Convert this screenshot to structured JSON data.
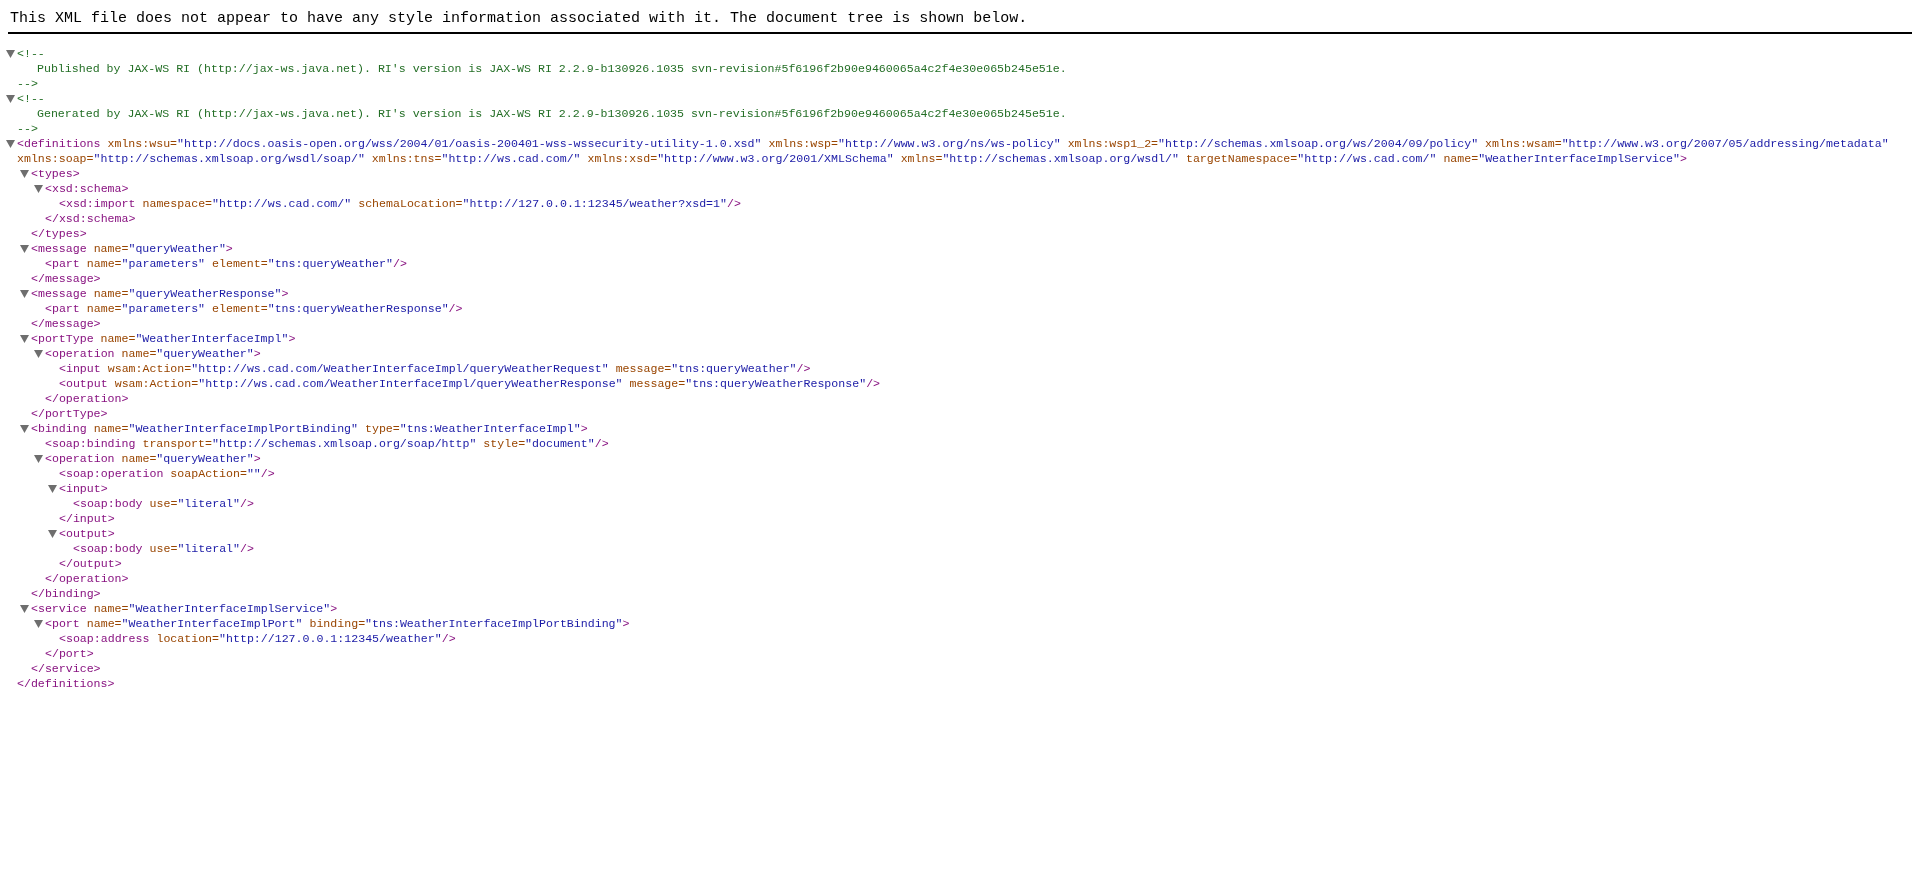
{
  "notice": "This XML file does not appear to have any style information associated with it. The document tree is shown below.",
  "tree": [
    {
      "kind": "comment",
      "expanded": true,
      "open": "<!--",
      "text": "Published by JAX-WS RI (http://jax-ws.java.net). RI's version is JAX-WS RI 2.2.9-b130926.1035 svn-revision#5f6196f2b90e9460065a4c2f4e30e065b245e51e.",
      "close": "-->"
    },
    {
      "kind": "comment",
      "expanded": true,
      "open": "<!--",
      "text": "Generated by JAX-WS RI (http://jax-ws.java.net). RI's version is JAX-WS RI 2.2.9-b130926.1035 svn-revision#5f6196f2b90e9460065a4c2f4e30e065b245e51e.",
      "close": "-->"
    },
    {
      "kind": "element",
      "expanded": true,
      "start": "<definitions",
      "attrs": [
        {
          "name": "xmlns:wsu=",
          "value": "\"http://docs.oasis-open.org/wss/2004/01/oasis-200401-wss-wssecurity-utility-1.0.xsd\""
        },
        {
          "name": "xmlns:wsp=",
          "value": "\"http://www.w3.org/ns/ws-policy\""
        },
        {
          "name": "xmlns:wsp1_2=",
          "value": "\"http://schemas.xmlsoap.org/ws/2004/09/policy\""
        },
        {
          "name": "xmlns:wsam=",
          "value": "\"http://www.w3.org/2007/05/addressing/metadata\""
        },
        {
          "name": "xmlns:soap=",
          "value": "\"http://schemas.xmlsoap.org/wsdl/soap/\""
        },
        {
          "name": "xmlns:tns=",
          "value": "\"http://ws.cad.com/\""
        },
        {
          "name": "xmlns:xsd=",
          "value": "\"http://www.w3.org/2001/XMLSchema\""
        },
        {
          "name": "xmlns=",
          "value": "\"http://schemas.xmlsoap.org/wsdl/\""
        },
        {
          "name": "targetNamespace=",
          "value": "\"http://ws.cad.com/\""
        },
        {
          "name": "name=",
          "value": "\"WeatherInterfaceImplService\""
        }
      ],
      "end": ">",
      "close": "</definitions>",
      "children": [
        {
          "kind": "element",
          "expanded": true,
          "start": "<types",
          "end": ">",
          "close": "</types>",
          "children": [
            {
              "kind": "element",
              "expanded": true,
              "start": "<xsd:schema",
              "end": ">",
              "close": "</xsd:schema>",
              "children": [
                {
                  "kind": "element",
                  "start": "<xsd:import",
                  "attrs": [
                    {
                      "name": "namespace=",
                      "value": "\"http://ws.cad.com/\""
                    },
                    {
                      "name": "schemaLocation=",
                      "value": "\"http://127.0.0.1:12345/weather?xsd=1\""
                    }
                  ],
                  "end": "/>"
                }
              ]
            }
          ]
        },
        {
          "kind": "element",
          "expanded": true,
          "start": "<message",
          "attrs": [
            {
              "name": "name=",
              "value": "\"queryWeather\""
            }
          ],
          "end": ">",
          "close": "</message>",
          "children": [
            {
              "kind": "element",
              "start": "<part",
              "attrs": [
                {
                  "name": "name=",
                  "value": "\"parameters\""
                },
                {
                  "name": "element=",
                  "value": "\"tns:queryWeather\""
                }
              ],
              "end": "/>"
            }
          ]
        },
        {
          "kind": "element",
          "expanded": true,
          "start": "<message",
          "attrs": [
            {
              "name": "name=",
              "value": "\"queryWeatherResponse\""
            }
          ],
          "end": ">",
          "close": "</message>",
          "children": [
            {
              "kind": "element",
              "start": "<part",
              "attrs": [
                {
                  "name": "name=",
                  "value": "\"parameters\""
                },
                {
                  "name": "element=",
                  "value": "\"tns:queryWeatherResponse\""
                }
              ],
              "end": "/>"
            }
          ]
        },
        {
          "kind": "element",
          "expanded": true,
          "start": "<portType",
          "attrs": [
            {
              "name": "name=",
              "value": "\"WeatherInterfaceImpl\""
            }
          ],
          "end": ">",
          "close": "</portType>",
          "children": [
            {
              "kind": "element",
              "expanded": true,
              "start": "<operation",
              "attrs": [
                {
                  "name": "name=",
                  "value": "\"queryWeather\""
                }
              ],
              "end": ">",
              "close": "</operation>",
              "children": [
                {
                  "kind": "element",
                  "start": "<input",
                  "attrs": [
                    {
                      "name": "wsam:Action=",
                      "value": "\"http://ws.cad.com/WeatherInterfaceImpl/queryWeatherRequest\""
                    },
                    {
                      "name": "message=",
                      "value": "\"tns:queryWeather\""
                    }
                  ],
                  "end": "/>"
                },
                {
                  "kind": "element",
                  "start": "<output",
                  "attrs": [
                    {
                      "name": "wsam:Action=",
                      "value": "\"http://ws.cad.com/WeatherInterfaceImpl/queryWeatherResponse\""
                    },
                    {
                      "name": "message=",
                      "value": "\"tns:queryWeatherResponse\""
                    }
                  ],
                  "end": "/>"
                }
              ]
            }
          ]
        },
        {
          "kind": "element",
          "expanded": true,
          "start": "<binding",
          "attrs": [
            {
              "name": "name=",
              "value": "\"WeatherInterfaceImplPortBinding\""
            },
            {
              "name": "type=",
              "value": "\"tns:WeatherInterfaceImpl\""
            }
          ],
          "end": ">",
          "close": "</binding>",
          "children": [
            {
              "kind": "element",
              "start": "<soap:binding",
              "attrs": [
                {
                  "name": "transport=",
                  "value": "\"http://schemas.xmlsoap.org/soap/http\""
                },
                {
                  "name": "style=",
                  "value": "\"document\""
                }
              ],
              "end": "/>"
            },
            {
              "kind": "element",
              "expanded": true,
              "start": "<operation",
              "attrs": [
                {
                  "name": "name=",
                  "value": "\"queryWeather\""
                }
              ],
              "end": ">",
              "close": "</operation>",
              "children": [
                {
                  "kind": "element",
                  "start": "<soap:operation",
                  "attrs": [
                    {
                      "name": "soapAction=",
                      "value": "\"\""
                    }
                  ],
                  "end": "/>"
                },
                {
                  "kind": "element",
                  "expanded": true,
                  "start": "<input",
                  "end": ">",
                  "close": "</input>",
                  "children": [
                    {
                      "kind": "element",
                      "start": "<soap:body",
                      "attrs": [
                        {
                          "name": "use=",
                          "value": "\"literal\""
                        }
                      ],
                      "end": "/>"
                    }
                  ]
                },
                {
                  "kind": "element",
                  "expanded": true,
                  "start": "<output",
                  "end": ">",
                  "close": "</output>",
                  "children": [
                    {
                      "kind": "element",
                      "start": "<soap:body",
                      "attrs": [
                        {
                          "name": "use=",
                          "value": "\"literal\""
                        }
                      ],
                      "end": "/>"
                    }
                  ]
                }
              ]
            }
          ]
        },
        {
          "kind": "element",
          "expanded": true,
          "start": "<service",
          "attrs": [
            {
              "name": "name=",
              "value": "\"WeatherInterfaceImplService\""
            }
          ],
          "end": ">",
          "close": "</service>",
          "children": [
            {
              "kind": "element",
              "expanded": true,
              "start": "<port",
              "attrs": [
                {
                  "name": "name=",
                  "value": "\"WeatherInterfaceImplPort\""
                },
                {
                  "name": "binding=",
                  "value": "\"tns:WeatherInterfaceImplPortBinding\""
                }
              ],
              "end": ">",
              "close": "</port>",
              "children": [
                {
                  "kind": "element",
                  "start": "<soap:address",
                  "attrs": [
                    {
                      "name": "location=",
                      "value": "\"http://127.0.0.1:12345/weather\""
                    }
                  ],
                  "end": "/>"
                }
              ]
            }
          ]
        }
      ]
    }
  ]
}
